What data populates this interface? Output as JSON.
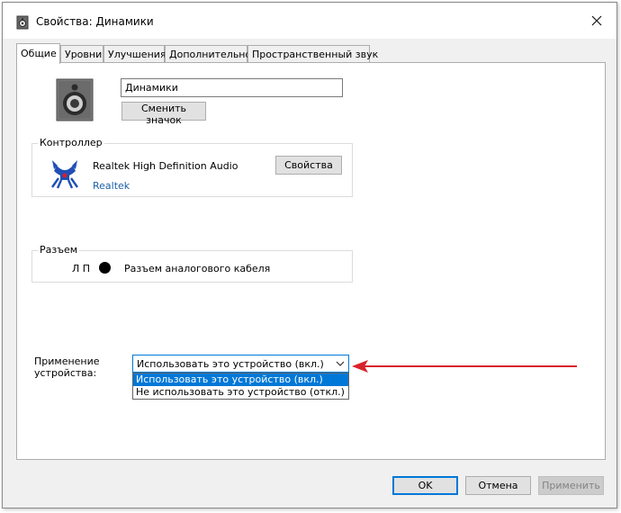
{
  "window": {
    "title": "Свойства: Динамики",
    "close_glyph": "✕"
  },
  "tabs": [
    {
      "label": "Общие",
      "active": true
    },
    {
      "label": "Уровни"
    },
    {
      "label": "Улучшения"
    },
    {
      "label": "Дополнительно"
    },
    {
      "label": "Пространственный звук"
    }
  ],
  "device": {
    "name_value": "Динамики",
    "change_icon_label": "Сменить значок"
  },
  "controller": {
    "group_title": "Контроллер",
    "name": "Realtek High Definition Audio",
    "vendor": "Realtek",
    "properties_label": "Свойства"
  },
  "jack": {
    "group_title": "Разъем",
    "channels": "Л П",
    "label": "Разъем аналогового кабеля"
  },
  "usage": {
    "label_line1": "Применение",
    "label_line2": "устройства:",
    "selected": "Использовать это устройство (вкл.)",
    "options": [
      "Использовать это устройство (вкл.)",
      "Не использовать это устройство (откл.)"
    ]
  },
  "footer": {
    "ok_label": "OK",
    "cancel_label": "Отмена",
    "apply_label": "Применить"
  },
  "colors": {
    "accent": "#0078d7",
    "annotation_arrow": "#d8232a",
    "link": "#1a5fa8"
  },
  "icons": [
    "speaker-properties-icon",
    "close-icon",
    "speaker-icon",
    "realtek-logo-icon",
    "chevron-down-icon",
    "red-arrow-annotation"
  ]
}
